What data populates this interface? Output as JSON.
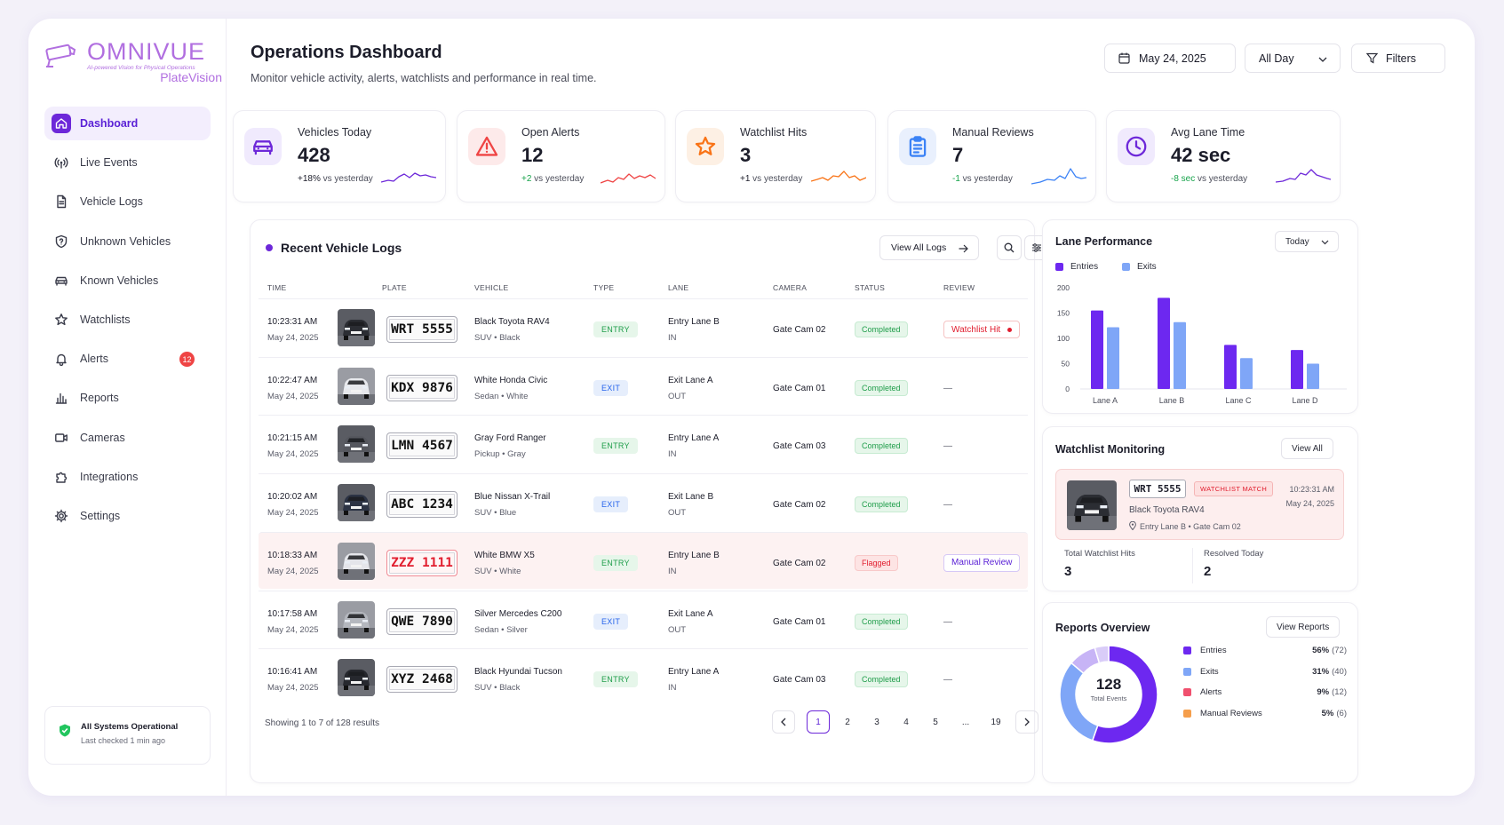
{
  "brand": {
    "name": "OMNIVUE",
    "tagline": "AI-powered Vision for Physical Operations",
    "product": "PlateVision"
  },
  "sidebar": {
    "items": [
      {
        "label": "Dashboard",
        "icon": "home-icon",
        "active": true
      },
      {
        "label": "Live Events",
        "icon": "broadcast-icon"
      },
      {
        "label": "Vehicle Logs",
        "icon": "document-icon"
      },
      {
        "label": "Unknown Vehicles",
        "icon": "shield-question-icon"
      },
      {
        "label": "Known Vehicles",
        "icon": "car-icon"
      },
      {
        "label": "Watchlists",
        "icon": "star-icon"
      },
      {
        "label": "Alerts",
        "icon": "bell-icon",
        "badge": "12"
      },
      {
        "label": "Reports",
        "icon": "bar-chart-icon"
      },
      {
        "label": "Cameras",
        "icon": "video-camera-icon"
      },
      {
        "label": "Integrations",
        "icon": "puzzle-icon"
      },
      {
        "label": "Settings",
        "icon": "gear-icon"
      }
    ],
    "status": {
      "title": "All Systems Operational",
      "subtitle": "Last checked 1 min ago"
    }
  },
  "header": {
    "title": "Operations Dashboard",
    "subtitle": "Monitor vehicle activity, alerts, watchlists and performance in real time.",
    "date": "May 24, 2025",
    "range": "All Day",
    "filters": "Filters"
  },
  "kpis": [
    {
      "label": "Vehicles Today",
      "value": "428",
      "delta": "+18%",
      "delta_text": " vs yesterday",
      "color": "#6d28d9",
      "icon": "car-icon"
    },
    {
      "label": "Open Alerts",
      "value": "12",
      "delta": "+2",
      "delta_text": " vs yesterday",
      "color": "#ef4444",
      "icon": "alert-triangle-icon"
    },
    {
      "label": "Watchlist Hits",
      "value": "3",
      "delta": "+1",
      "delta_text": " vs yesterday",
      "color": "#f97316",
      "icon": "star-icon"
    },
    {
      "label": "Manual Reviews",
      "value": "7",
      "delta": "-1",
      "delta_text": " vs yesterday",
      "color": "#3b82f6",
      "icon": "clipboard-icon"
    },
    {
      "label": "Avg Lane Time",
      "value": "42 sec",
      "delta": "-8 sec",
      "delta_text": " vs yesterday",
      "color": "#6d28d9",
      "icon": "clock-icon"
    }
  ],
  "logs": {
    "title": "Recent Vehicle Logs",
    "view_all": "View All Logs",
    "columns": [
      "TIME",
      "PLATE",
      "VEHICLE",
      "TYPE",
      "LANE",
      "CAMERA",
      "STATUS",
      "REVIEW"
    ],
    "rows": [
      {
        "time": "10:23:31 AM",
        "date": "May 24, 2025",
        "plate": "WRT 5555",
        "vehicle": "Black Toyota RAV4",
        "sub": "SUV  •  Black",
        "type": "ENTRY",
        "lane": "Entry Lane B",
        "dir": "IN",
        "camera": "Gate Cam 02",
        "status": "Completed",
        "review": "Watchlist Hit",
        "car_color": "#2b2d33"
      },
      {
        "time": "10:22:47 AM",
        "date": "May 24, 2025",
        "plate": "KDX 9876",
        "vehicle": "White Honda Civic",
        "sub": "Sedan  •  White",
        "type": "EXIT",
        "lane": "Exit Lane A",
        "dir": "OUT",
        "camera": "Gate Cam 01",
        "status": "Completed",
        "review": "—",
        "car_color": "#e7e8ec"
      },
      {
        "time": "10:21:15 AM",
        "date": "May 24, 2025",
        "plate": "LMN 4567",
        "vehicle": "Gray Ford Ranger",
        "sub": "Pickup  •  Gray",
        "type": "ENTRY",
        "lane": "Entry Lane A",
        "dir": "IN",
        "camera": "Gate Cam 03",
        "status": "Completed",
        "review": "—",
        "car_color": "#55575e"
      },
      {
        "time": "10:20:02 AM",
        "date": "May 24, 2025",
        "plate": "ABC 1234",
        "vehicle": "Blue Nissan X-Trail",
        "sub": "SUV  •  Blue",
        "type": "EXIT",
        "lane": "Exit Lane B",
        "dir": "OUT",
        "camera": "Gate Cam 02",
        "status": "Completed",
        "review": "—",
        "car_color": "#2c3344"
      },
      {
        "time": "10:18:33 AM",
        "date": "May 24, 2025",
        "plate": "ZZZ 1111",
        "vehicle": "White BMW X5",
        "sub": "SUV  •  White",
        "type": "ENTRY",
        "lane": "Entry Lane B",
        "dir": "IN",
        "camera": "Gate Cam 02",
        "status": "Flagged",
        "review": "Manual Review",
        "car_color": "#e4e5ea"
      },
      {
        "time": "10:17:58 AM",
        "date": "May 24, 2025",
        "plate": "QWE 7890",
        "vehicle": "Silver Mercedes C200",
        "sub": "Sedan  •  Silver",
        "type": "EXIT",
        "lane": "Exit Lane A",
        "dir": "OUT",
        "camera": "Gate Cam 01",
        "status": "Completed",
        "review": "—",
        "car_color": "#b4b7be"
      },
      {
        "time": "10:16:41 AM",
        "date": "May 24, 2025",
        "plate": "XYZ 2468",
        "vehicle": "Black Hyundai Tucson",
        "sub": "SUV  •  Black",
        "type": "ENTRY",
        "lane": "Entry Lane A",
        "dir": "IN",
        "camera": "Gate Cam 03",
        "status": "Completed",
        "review": "—",
        "car_color": "#26282e"
      }
    ],
    "showing": "Showing 1 to 7 of 128 results",
    "pages": [
      "1",
      "2",
      "3",
      "4",
      "5",
      "...",
      "19"
    ],
    "current_page": "1"
  },
  "lane_perf": {
    "title": "Lane Performance",
    "range": "Today",
    "chart_data": {
      "type": "bar",
      "categories": [
        "Lane A",
        "Lane B",
        "Lane C",
        "Lane D"
      ],
      "series": [
        {
          "name": "Entries",
          "values": [
            155,
            180,
            87,
            77
          ],
          "color": "#6d28f0"
        },
        {
          "name": "Exits",
          "values": [
            122,
            132,
            61,
            50
          ],
          "color": "#7fa6f7"
        }
      ],
      "ylim": [
        0,
        200
      ],
      "yticks": [
        0,
        50,
        100,
        150,
        200
      ]
    }
  },
  "watchlist": {
    "title": "Watchlist Monitoring",
    "view_all": "View All",
    "match": {
      "plate": "WRT 5555",
      "badge": "WATCHLIST MATCH",
      "vehicle": "Black Toyota RAV4",
      "location": "Entry Lane B  •  Gate Cam 02",
      "time": "10:23:31 AM",
      "date": "May 24, 2025"
    },
    "stats": [
      {
        "label": "Total Watchlist Hits",
        "value": "3"
      },
      {
        "label": "Resolved Today",
        "value": "2"
      }
    ]
  },
  "reports": {
    "title": "Reports Overview",
    "view": "View Reports",
    "total": "128",
    "total_label": "Total Events",
    "chart_data": {
      "type": "pie",
      "slices": [
        {
          "label": "Entries",
          "pct": "56%",
          "count": "(72)",
          "value": 72,
          "color": "#6d28f0"
        },
        {
          "label": "Exits",
          "pct": "31%",
          "count": "(40)",
          "value": 40,
          "color": "#7fa6f7"
        },
        {
          "label": "Alerts",
          "pct": "9%",
          "count": "(12)",
          "value": 12,
          "color": "#f0506e"
        },
        {
          "label": "Manual Reviews",
          "pct": "5%",
          "count": "(6)",
          "value": 6,
          "color": "#f59e4b"
        }
      ]
    },
    "ring_colors": [
      "#6d28f0",
      "#7fa6f7",
      "#c7b4f6",
      "#d9ccf8"
    ]
  }
}
